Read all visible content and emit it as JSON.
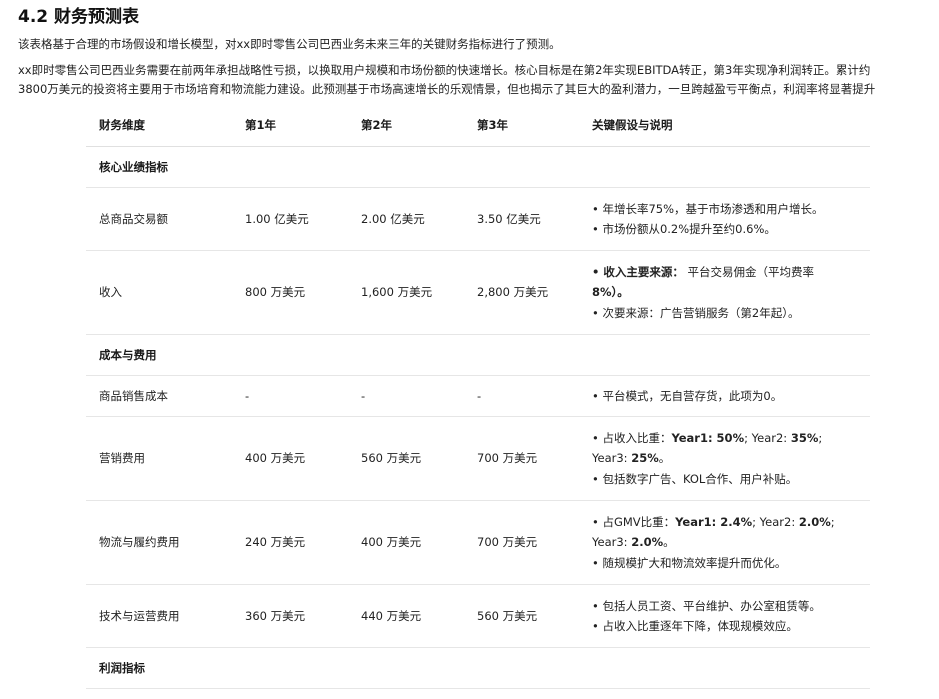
{
  "section": {
    "title": "4.2 财务预测表",
    "intro": "该表格基于合理的市场假设和增长模型，对xx即时零售公司巴西业务未来三年的关键财务指标进行了预测。",
    "summary_line1": "xx即时零售公司巴西业务需要在前两年承担战略性亏损，以换取用户规模和市场份额的快速增长。核心目标是在第2年实现EBITDA转正，第3年实现净利润转正。累计约",
    "summary_line2": "3800万美元的投资将主要用于市场培育和物流能力建设。此预测基于市场高速增长的乐观情景，但也揭示了其巨大的盈利潜力，一旦跨越盈亏平衡点，利润率将显著提升"
  },
  "table": {
    "headers": [
      "财务维度",
      "第1年",
      "第2年",
      "第3年",
      "关键假设与说明"
    ],
    "group_core": "核心业绩指标",
    "group_cost": "成本与费用",
    "group_profit": "利润指标",
    "gmv": {
      "label": "总商品交易额",
      "y1": "1.00 亿美元",
      "y2": "2.00 亿美元",
      "y3": "3.50 亿美元",
      "note1": "• 年增长率75%，基于市场渗透和用户增长。",
      "note2": "• 市场份额从0.2%提升至约0.6%。"
    },
    "revenue": {
      "label": "收入",
      "y1": "800 万美元",
      "y2": "1,600 万美元",
      "y3": "2,800 万美元",
      "note1_bold": "• 收入主要来源：",
      "note1_rest": "平台交易佣金（平均费率",
      "note2": "8%）。",
      "note3": "• 次要来源：广告营销服务（第2年起）。"
    },
    "cogs": {
      "label": "商品销售成本",
      "y1": "-",
      "y2": "-",
      "y3": "-",
      "note1": "• 平台模式，无自营存货，此项为0。"
    },
    "marketing": {
      "label": "营销费用",
      "y1": "400 万美元",
      "y2": "560 万美元",
      "y3": "700 万美元",
      "note1_a": "• 占收入比重：",
      "note1_b": "Year1: 50%",
      "note1_c": "; Year2: ",
      "note1_d": "35%",
      "note1_e": ";",
      "note2_a": "Year3: ",
      "note2_b": "25%",
      "note2_c": "。",
      "note3": "• 包括数字广告、KOL合作、用户补贴。"
    },
    "logistics": {
      "label": "物流与履约费用",
      "y1": "240 万美元",
      "y2": "400 万美元",
      "y3": "700 万美元",
      "note1_a": "• 占GMV比重：",
      "note1_b": "Year1: 2.4%",
      "note1_c": "; Year2: ",
      "note1_d": "2.0%",
      "note1_e": ";",
      "note2_a": "Year3: ",
      "note2_b": "2.0%",
      "note2_c": "。",
      "note3": "• 随规模扩大和物流效率提升而优化。"
    },
    "tech": {
      "label": "技术与运营费用",
      "y1": "360 万美元",
      "y2": "440 万美元",
      "y3": "560 万美元",
      "note1": "• 包括人员工资、平台维护、办公室租赁等。",
      "note2": "• 占收入比重逐年下降，体现规模效应。"
    }
  }
}
